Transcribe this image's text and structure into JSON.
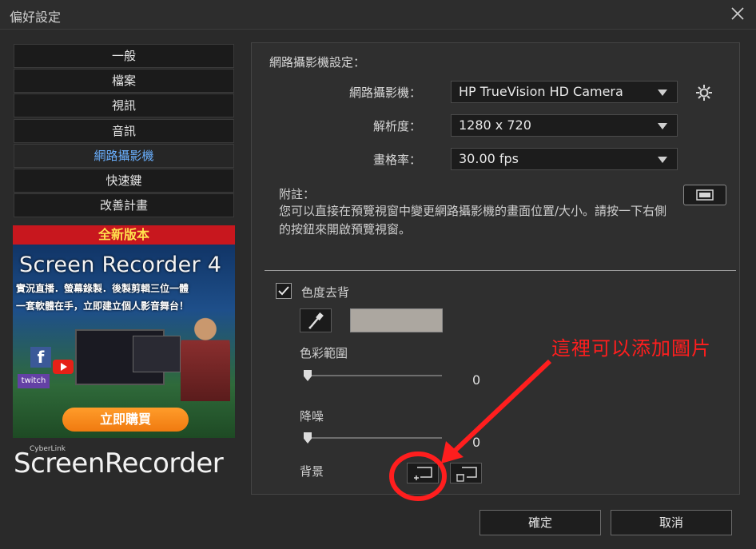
{
  "window": {
    "title": "偏好設定"
  },
  "nav": {
    "items": [
      {
        "label": "一般",
        "active": false
      },
      {
        "label": "檔案",
        "active": false
      },
      {
        "label": "視訊",
        "active": false
      },
      {
        "label": "音訊",
        "active": false
      },
      {
        "label": "網路攝影機",
        "active": true
      },
      {
        "label": "快速鍵",
        "active": false
      },
      {
        "label": "改善計畫",
        "active": false
      }
    ]
  },
  "banner": {
    "top_label": "全新版本",
    "product": "Screen Recorder 4",
    "line1": "實況直播．螢幕錄製．後製剪輯三位一體",
    "line2": "一套軟體在手，立即建立個人影音舞台！",
    "fb_glyph": "f",
    "twitch_label": "twitch",
    "buy_label": "立即購買"
  },
  "brand": {
    "small": "CyberLink",
    "name": "ScreenRecorder"
  },
  "webcam": {
    "section_title": "網路攝影機設定：",
    "camera_label": "網路攝影機：",
    "camera_value": "HP TrueVision HD Camera",
    "resolution_label": "解析度：",
    "resolution_value": "1280 x 720",
    "framerate_label": "畫格率：",
    "framerate_value": "30.00 fps",
    "note_label": "附註：",
    "note_text": "您可以直接在預覽視窗中變更網路攝影機的畫面位置/大小。請按一下右側的按鈕來開啟預覽視窗。"
  },
  "chroma": {
    "label": "色度去背",
    "checked": true,
    "color": "#aca7a0",
    "range_label": "色彩範圍",
    "range_value": "0",
    "noise_label": "降噪",
    "noise_value": "0",
    "background_label": "背景"
  },
  "footer": {
    "ok_label": "確定",
    "cancel_label": "取消"
  },
  "annotation": {
    "text": "這裡可以添加圖片",
    "color": "#ff1e1e"
  },
  "colors": {
    "accent": "#6ab0ff",
    "panel": "#2f2f2f",
    "window": "#2a2a2a"
  }
}
